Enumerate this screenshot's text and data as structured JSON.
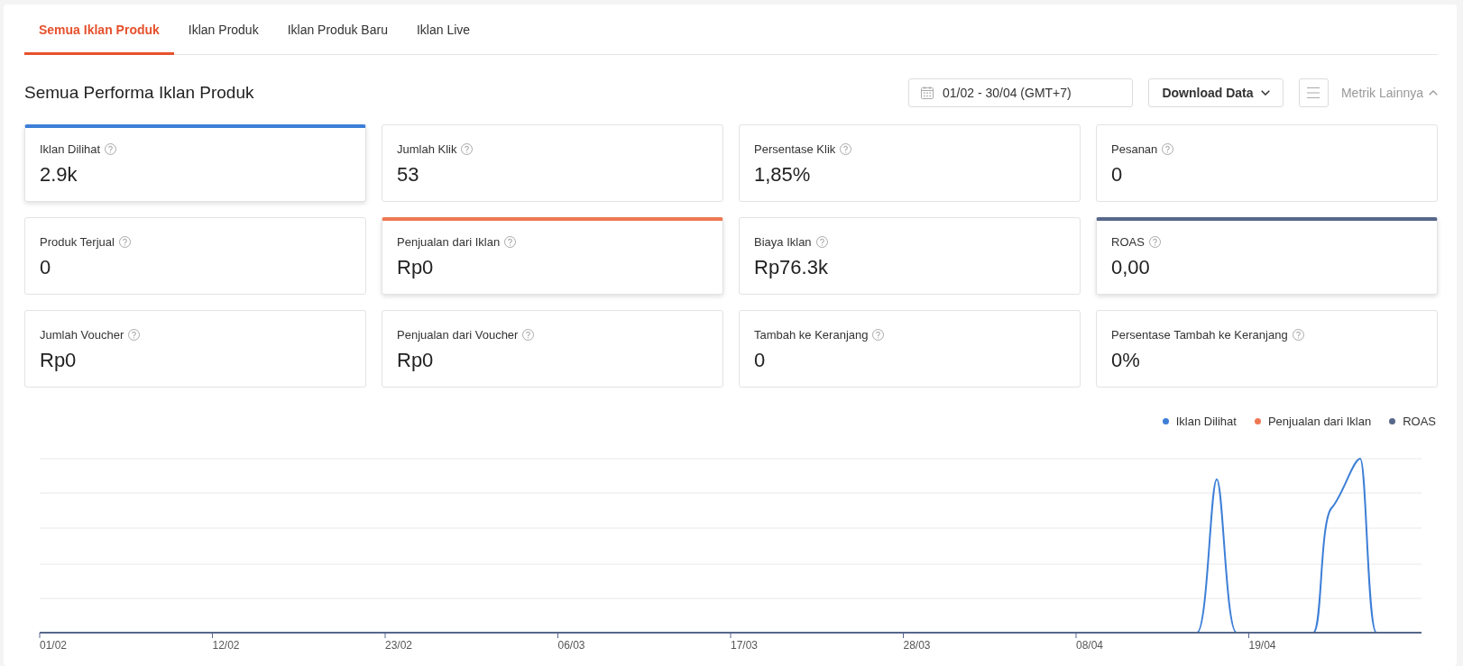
{
  "tabs": [
    {
      "label": "Semua Iklan Produk",
      "selected": true
    },
    {
      "label": "Iklan Produk",
      "selected": false
    },
    {
      "label": "Iklan Produk Baru",
      "selected": false
    },
    {
      "label": "Iklan Live",
      "selected": false
    }
  ],
  "header": {
    "title": "Semua Performa Iklan Produk",
    "date_range": "01/02 - 30/04 (GMT+7)",
    "download_button": "Download Data",
    "more_metrics": "Metrik Lainnya",
    "more_metrics_expanded": true
  },
  "metrics": [
    {
      "label": "Iklan Dilihat",
      "value": "2.9k",
      "selected": true,
      "color": "#3d7fd7"
    },
    {
      "label": "Jumlah Klik",
      "value": "53",
      "selected": false
    },
    {
      "label": "Persentase Klik",
      "value": "1,85%",
      "selected": false
    },
    {
      "label": "Pesanan",
      "value": "0",
      "selected": false
    },
    {
      "label": "Produk Terjual",
      "value": "0",
      "selected": false
    },
    {
      "label": "Penjualan dari Iklan",
      "value": "Rp0",
      "selected": true,
      "color": "#ee7852"
    },
    {
      "label": "Biaya Iklan",
      "value": "Rp76.3k",
      "selected": false
    },
    {
      "label": "ROAS",
      "value": "0,00",
      "selected": true,
      "color": "#56678a"
    },
    {
      "label": "Jumlah Voucher",
      "value": "Rp0",
      "selected": false
    },
    {
      "label": "Penjualan dari Voucher",
      "value": "Rp0",
      "selected": false
    },
    {
      "label": "Tambah ke Keranjang",
      "value": "0",
      "selected": false
    },
    {
      "label": "Persentase Tambah ke Keranjang",
      "value": "0%",
      "selected": false
    }
  ],
  "chart": {
    "legend": [
      {
        "label": "Iklan Dilihat",
        "color": "#3d7fd7"
      },
      {
        "label": "Penjualan dari Iklan",
        "color": "#ee7852"
      },
      {
        "label": "ROAS",
        "color": "#56678a"
      }
    ],
    "x_labels": [
      "01/02",
      "12/02",
      "23/02",
      "06/03",
      "17/03",
      "28/03",
      "08/04",
      "19/04"
    ]
  }
}
